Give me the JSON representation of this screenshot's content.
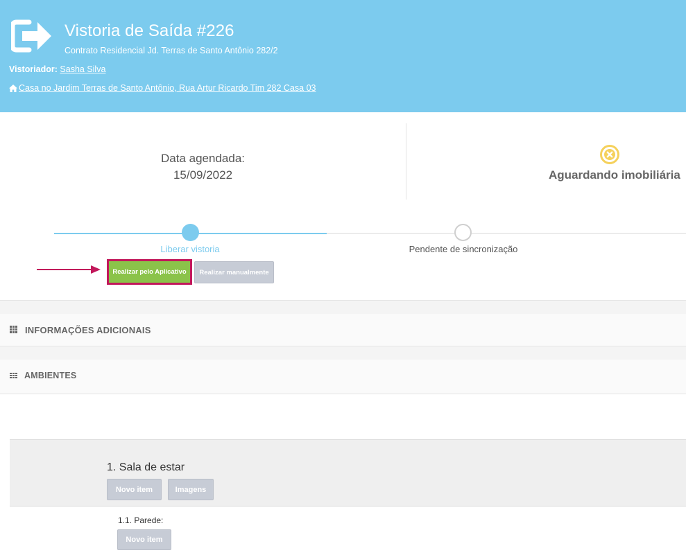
{
  "header": {
    "title": "Vistoria de Saída #226",
    "subtitle": "Contrato Residencial Jd. Terras de Santo Antônio 282/2",
    "inspector_label": "Vistoriador:",
    "inspector_name": "Sasha Silva",
    "address": "Casa no Jardim Terras de Santo Antônio, Rua Artur Ricardo Tim 282 Casa 03",
    "exit_icon": "sign-out-icon",
    "address_icon": "home-icon",
    "background_color": "#7ccbee"
  },
  "info": {
    "date_label": "Data agendada:",
    "date_value": "15/09/2022",
    "status_text": "Aguardando imobiliária",
    "status_icon": "x-circle-icon",
    "status_color": "#f5d15c"
  },
  "steps": [
    {
      "label": "Liberar vistoria",
      "active": true
    },
    {
      "label": "Pendente de sincronização",
      "active": false
    }
  ],
  "actions": {
    "app_button": "Realizar pelo Aplicativo",
    "manual_button": "Realizar manualmente",
    "app_color": "#8bc34a",
    "highlight_color": "#c2185b"
  },
  "sections": {
    "additional_info": "INFORMAÇÕES ADICIONAIS",
    "rooms": "AMBIENTES"
  },
  "room": {
    "title": "1. Sala de estar",
    "new_item_button": "Novo item",
    "images_button": "Imagens",
    "items": [
      {
        "title": "1.1. Parede:",
        "new_item_button": "Novo item"
      }
    ]
  }
}
